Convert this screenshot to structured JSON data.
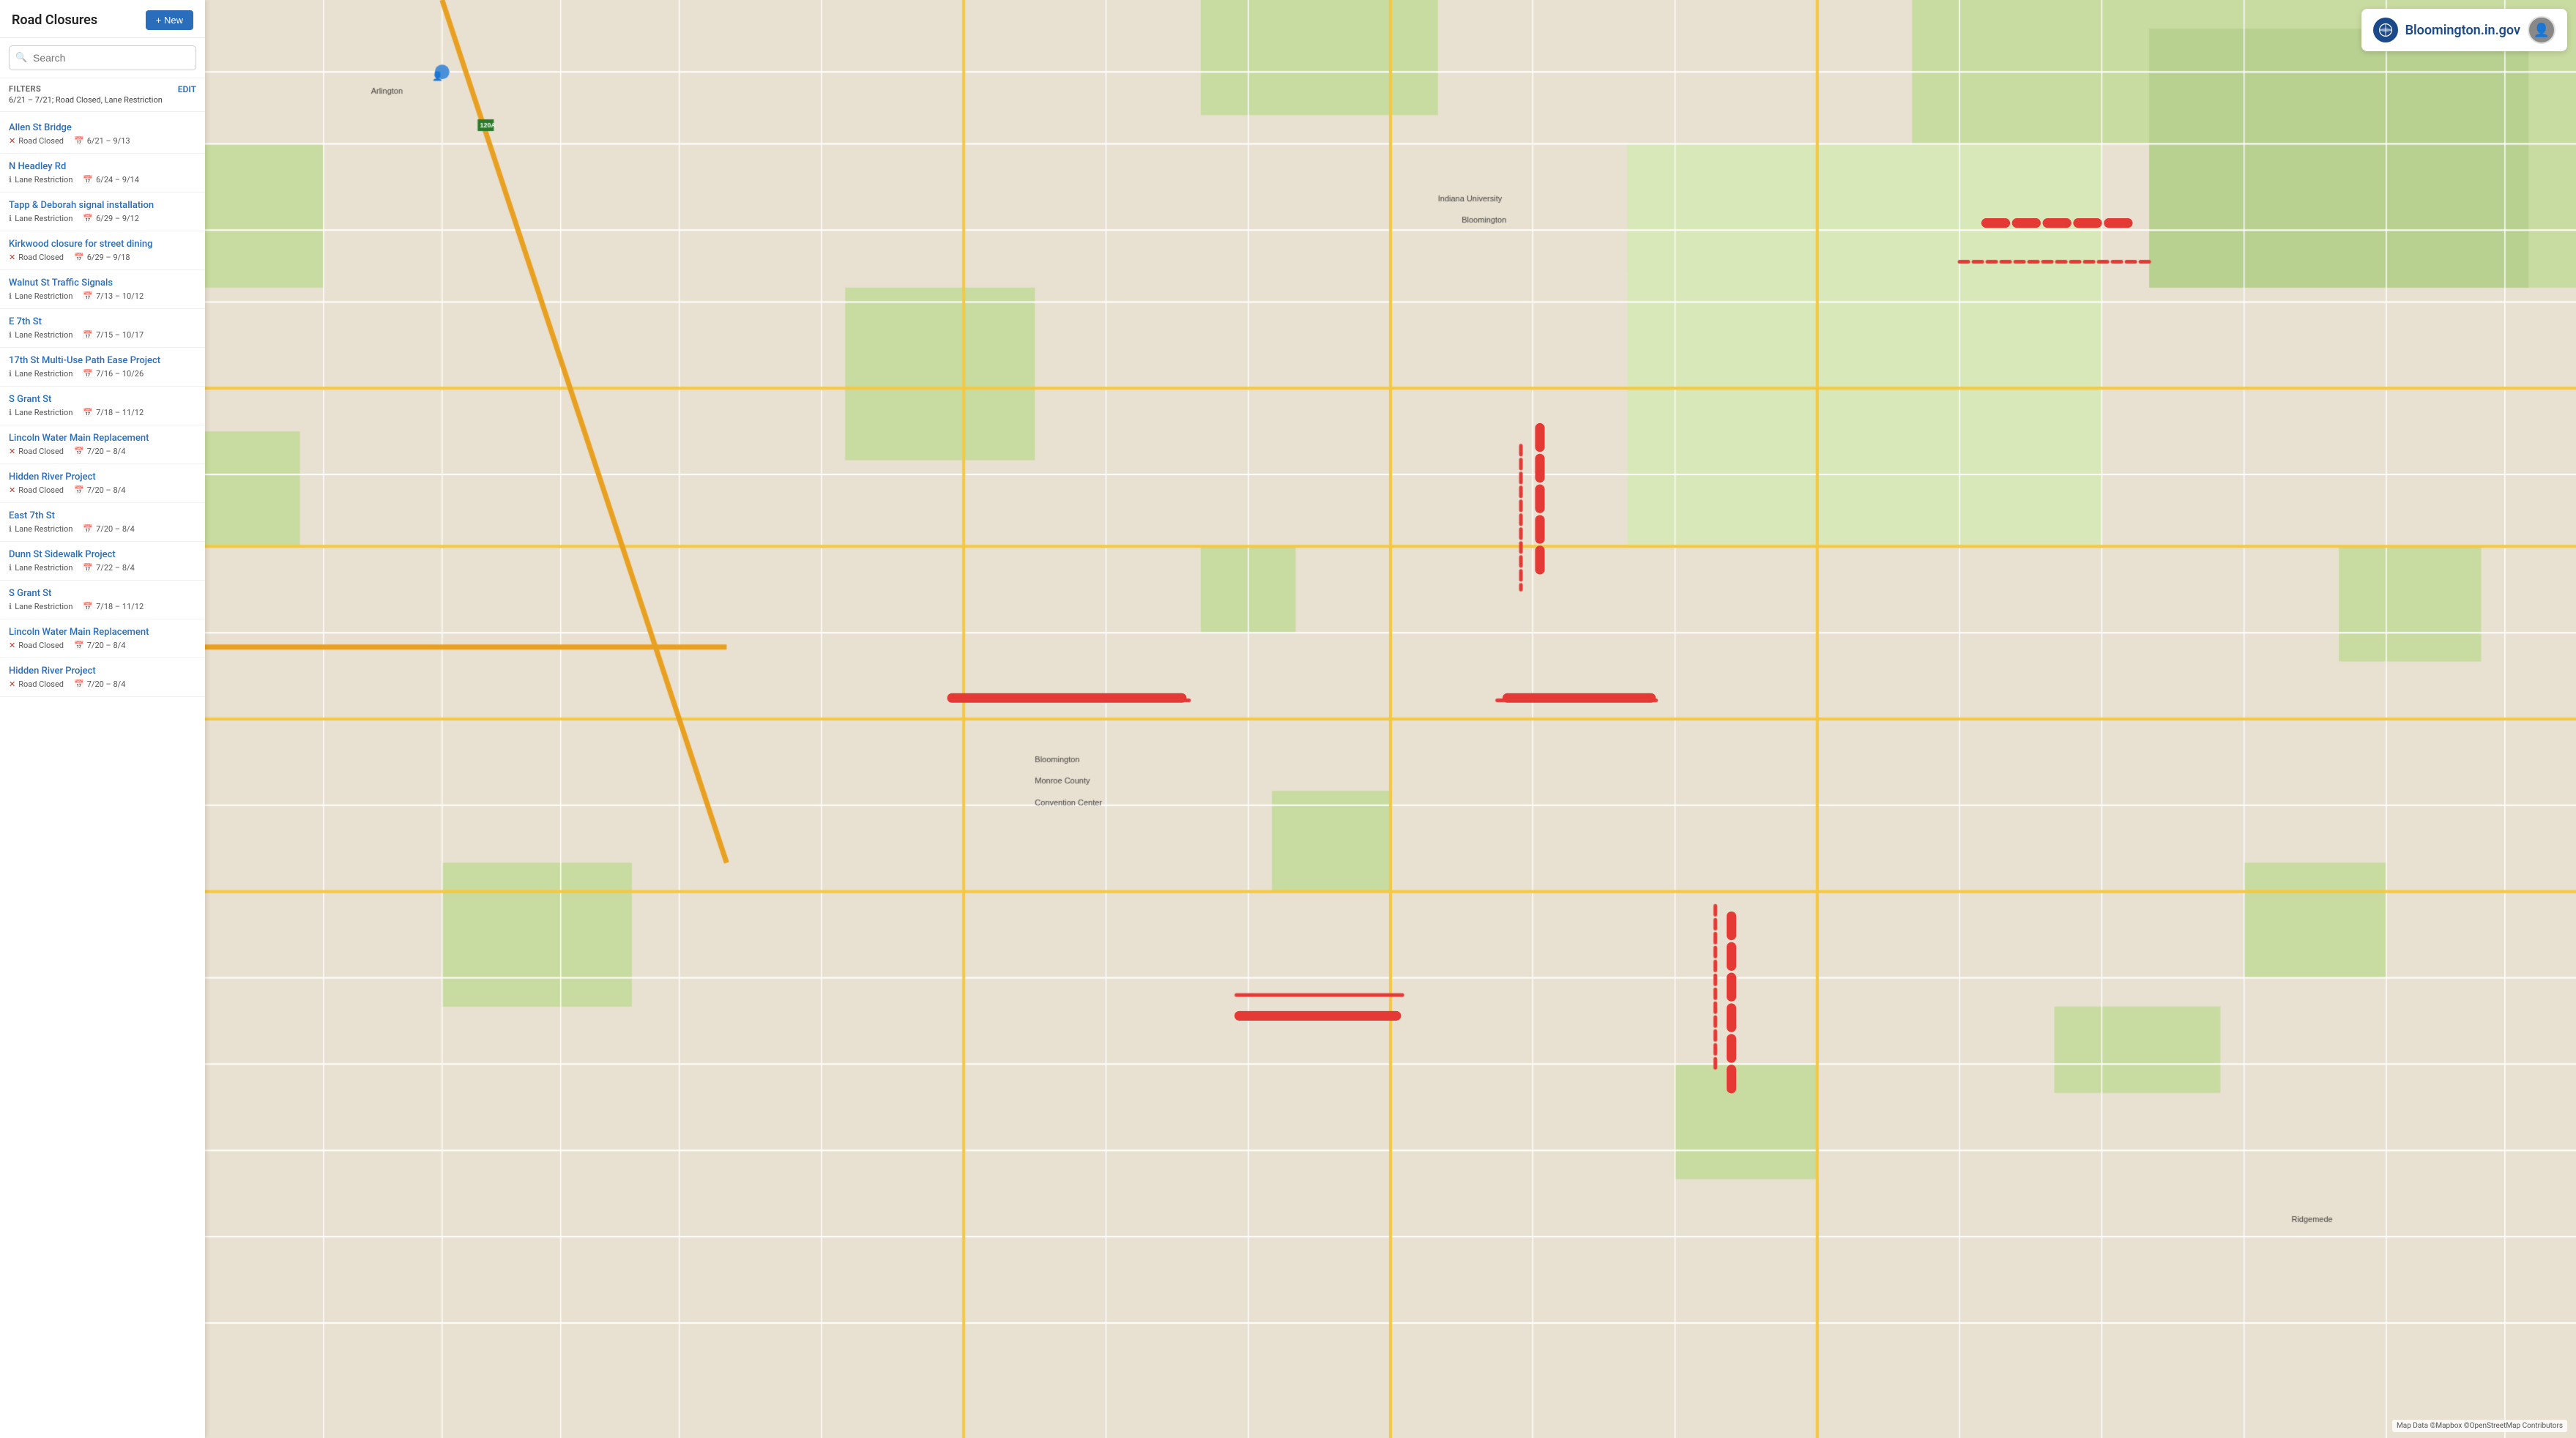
{
  "app": {
    "title": "Road Closures",
    "new_button": "+ New"
  },
  "search": {
    "placeholder": "Search"
  },
  "filters": {
    "label": "FILTERS",
    "value": "6/21 – 7/21; Road Closed, Lane Restriction",
    "edit_label": "EDIT"
  },
  "closures": [
    {
      "name": "Allen St Bridge",
      "type": "Road Closed",
      "type_icon": "x-circle",
      "date": "6/21 – 9/13"
    },
    {
      "name": "N Headley Rd",
      "type": "Lane Restriction",
      "type_icon": "info-circle",
      "date": "6/24 – 9/14"
    },
    {
      "name": "Tapp & Deborah signal installation",
      "type": "Lane Restriction",
      "type_icon": "info-circle",
      "date": "6/29 – 9/12"
    },
    {
      "name": "Kirkwood closure for street dining",
      "type": "Road Closed",
      "type_icon": "x-circle",
      "date": "6/29 – 9/18"
    },
    {
      "name": "Walnut St Traffic Signals",
      "type": "Lane Restriction",
      "type_icon": "info-circle",
      "date": "7/13 – 10/12"
    },
    {
      "name": "E 7th St",
      "type": "Lane Restriction",
      "type_icon": "info-circle",
      "date": "7/15 – 10/17"
    },
    {
      "name": "17th St Multi-Use Path Ease Project",
      "type": "Lane Restriction",
      "type_icon": "info-circle",
      "date": "7/16 – 10/26"
    },
    {
      "name": "S Grant St",
      "type": "Lane Restriction",
      "type_icon": "info-circle",
      "date": "7/18 – 11/12"
    },
    {
      "name": "Lincoln Water Main Replacement",
      "type": "Road Closed",
      "type_icon": "x-circle",
      "date": "7/20 – 8/4"
    },
    {
      "name": "Hidden River Project",
      "type": "Road Closed",
      "type_icon": "x-circle",
      "date": "7/20 – 8/4"
    },
    {
      "name": "East 7th St",
      "type": "Lane Restriction",
      "type_icon": "info-circle",
      "date": "7/20 – 8/4"
    },
    {
      "name": "Dunn St Sidewalk Project",
      "type": "Lane Restriction",
      "type_icon": "info-circle",
      "date": "7/22 – 8/4"
    },
    {
      "name": "S Grant St",
      "type": "Lane Restriction",
      "type_icon": "info-circle",
      "date": "7/18 – 11/12"
    },
    {
      "name": "Lincoln Water Main Replacement",
      "type": "Road Closed",
      "type_icon": "x-circle",
      "date": "7/20 – 8/4"
    },
    {
      "name": "Hidden River Project",
      "type": "Road Closed",
      "type_icon": "x-circle",
      "date": "7/20 – 8/4"
    }
  ],
  "brand": {
    "name": "Bloomington.in.gov"
  },
  "map_attribution": "Map Data ©Mapbox ©OpenStreetMap Contributors"
}
